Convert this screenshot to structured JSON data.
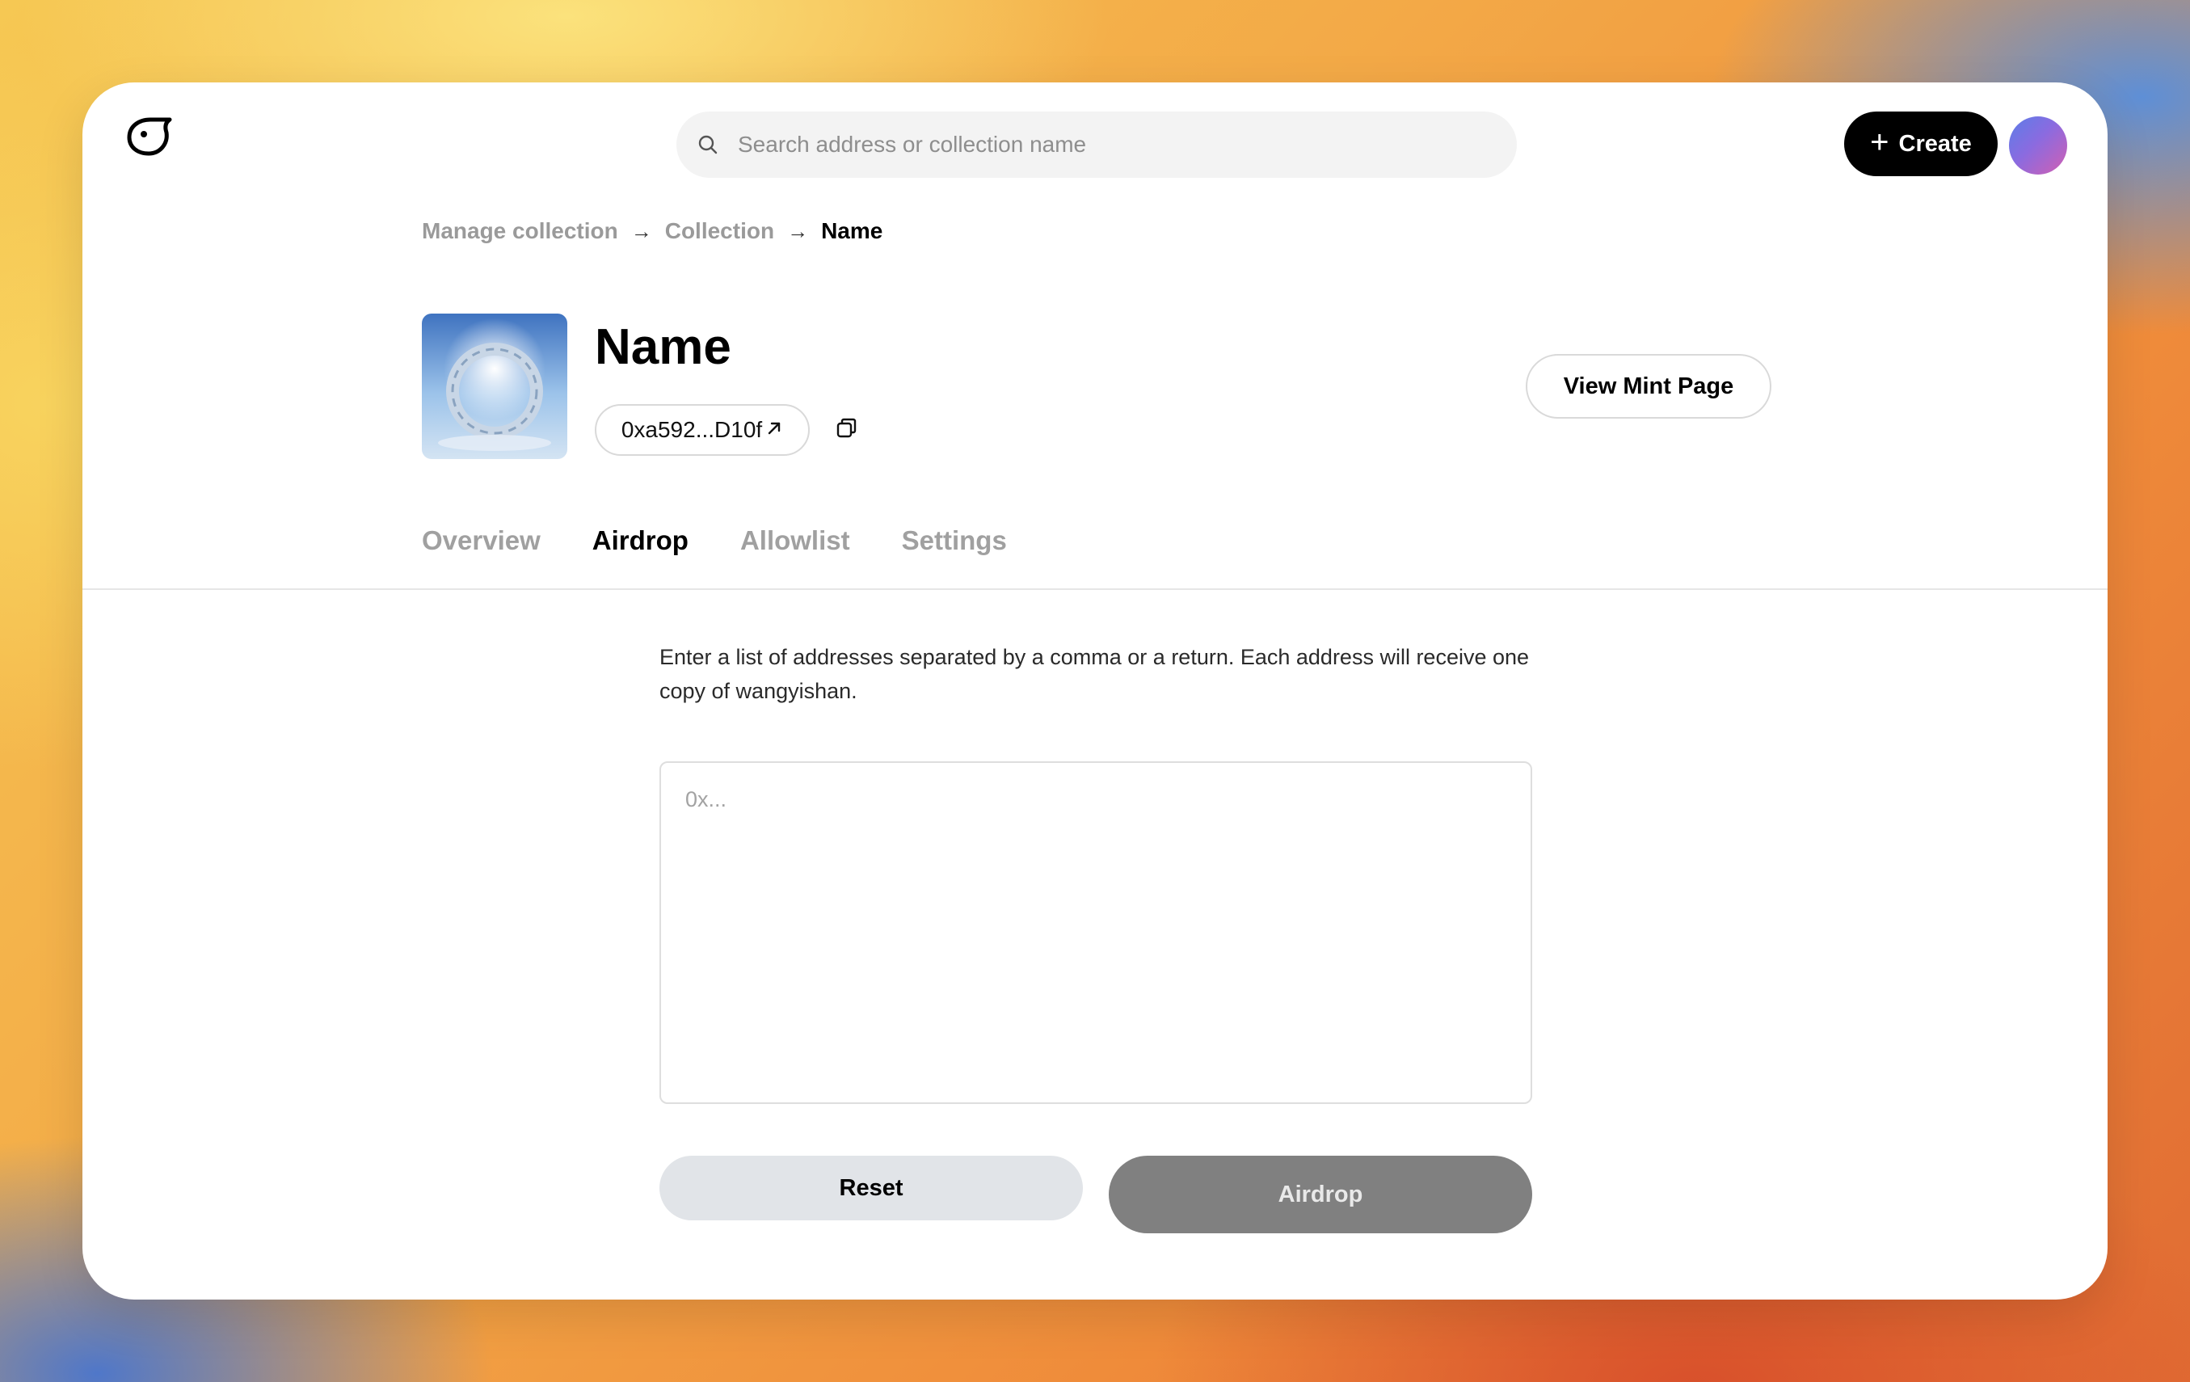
{
  "header": {
    "logo_icon": "bird-logo-icon",
    "search": {
      "placeholder": "Search address or collection name",
      "value": ""
    },
    "create_label": "Create"
  },
  "breadcrumb": {
    "items": [
      "Manage collection",
      "Collection",
      "Name"
    ]
  },
  "collection": {
    "name": "Name",
    "address": "0xa592...D10f",
    "view_mint_label": "View Mint Page"
  },
  "tabs": [
    {
      "label": "Overview",
      "active": false
    },
    {
      "label": "Airdrop",
      "active": true
    },
    {
      "label": "Allowlist",
      "active": false
    },
    {
      "label": "Settings",
      "active": false
    }
  ],
  "airdrop": {
    "description": "Enter a list of addresses separated by a comma or a return. Each address will receive one copy of wangyishan.",
    "textarea_placeholder": "0x...",
    "reset_label": "Reset",
    "airdrop_label": "Airdrop"
  },
  "colors": {
    "primary_button": "#000000",
    "disabled_button": "#808080",
    "secondary_button": "#e1e4e8"
  }
}
